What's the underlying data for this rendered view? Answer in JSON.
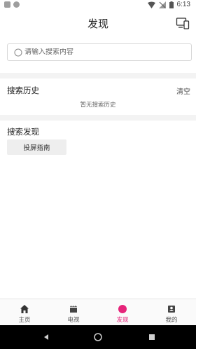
{
  "status_bar": {
    "time": "6:13"
  },
  "header": {
    "title": "发现"
  },
  "search": {
    "placeholder": "请输入搜索内容"
  },
  "history": {
    "title": "搜索历史",
    "clear_label": "清空",
    "empty_text": "暂无搜索历史"
  },
  "discover": {
    "title": "搜索发现",
    "tags": [
      "投屏指南"
    ]
  },
  "tabs": [
    {
      "label": "主页",
      "icon": "home-icon",
      "active": false
    },
    {
      "label": "电视",
      "icon": "tv-icon",
      "active": false
    },
    {
      "label": "发现",
      "icon": "discover-icon",
      "active": true
    },
    {
      "label": "我的",
      "icon": "profile-icon",
      "active": false
    }
  ],
  "colors": {
    "accent": "#e6247a",
    "divider": "#f3f3f3",
    "tag_bg": "#eeeeee"
  }
}
